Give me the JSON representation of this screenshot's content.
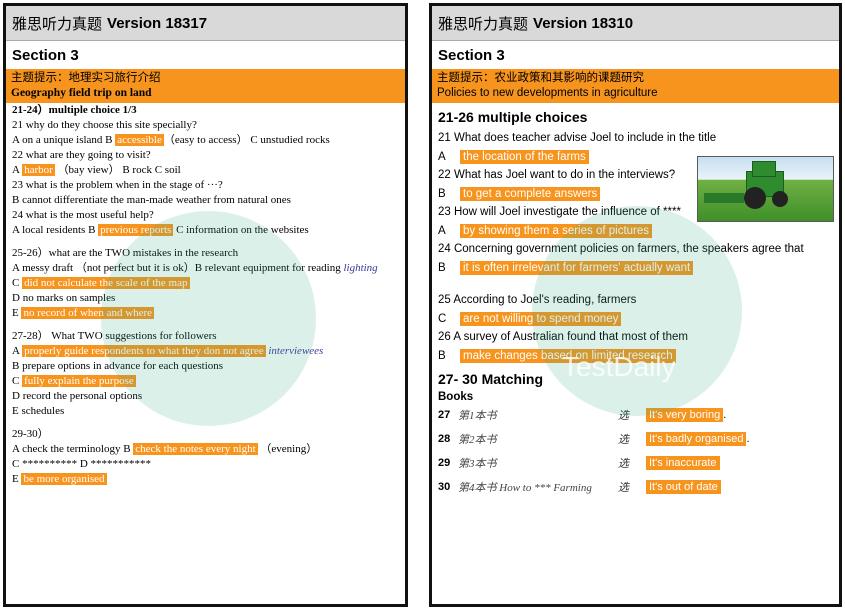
{
  "left": {
    "header_title": "雅思听力真题",
    "header_version": "Version 18317",
    "section": "Section 3",
    "topic_cn": "主题提示：地理实习旅行介绍",
    "topic_en": "Geography field trip on land",
    "q21_head": "21-24）multiple choice 1/3",
    "q21": "21 why do they choose this site specially?",
    "q21_a": "A on a unique island B",
    "q21_ans": "accessible",
    "q21_rest": "（easy to access） C unstudied rocks",
    "q22": "22 what are they going to visit?",
    "q22_a": "A",
    "q22_ans": "harbor",
    "q22_rest": "（bay view） B rock   C soil",
    "q23": "23 what is the problem when in the stage of ···?",
    "q23_b": "B cannot differentiate the man-made weather from natural ones",
    "q24": "24 what is the most useful help?",
    "q24_a": "A local residents        B",
    "q24_ans": "previous reports",
    "q24_rest": "C information on the websites",
    "q25_head": "25-26）what are the TWO mistakes in the research",
    "q25_a": "A messy draft  （not perfect but it is ok）B relevant equipment for reading",
    "q25_a_note": "lighting",
    "q25_c_letter": "C",
    "q25_c": "did not calculate the scale of the map",
    "q25_d": "D no marks on samples",
    "q25_e_letter": "E",
    "q25_e": "no record of when and where",
    "q27_head": "27-28）  What TWO suggestions for followers",
    "q27_a_letter": "A",
    "q27_a": "properly guide respondents to what they don not agree",
    "q27_a_note": "interviewees",
    "q27_b": "B prepare options in advance for each questions",
    "q27_c_letter": "C",
    "q27_c": "fully explain the purpose",
    "q27_d": "D record the personal options",
    "q27_e": "E schedules",
    "q29_head": "29-30）",
    "q29_a": "A check the terminology      B",
    "q29_ans": "check the notes every night",
    "q29_rest": "（evening）",
    "q29_cd": "C **********     D ***********",
    "q29_e_letter": "E",
    "q29_e": "be more organised"
  },
  "right": {
    "header_title": "雅思听力真题",
    "header_version": "Version 18310",
    "section": "Section 3",
    "topic_cn": "主题提示：农业政策和其影响的课题研究",
    "topic_en": "Policies to new developments in agriculture",
    "mc_head": "21-26 multiple choices",
    "q21": "21 What does teacher advise Joel to include in the title",
    "q21_letter": "A",
    "q21_ans": "the location of the farms",
    "q22": "22 What has Joel want to do in the interviews?",
    "q22_letter": "B",
    "q22_ans": "to get a complete answers",
    "q23": "23 How will Joel investigate the influence of ****",
    "q23_letter": "A",
    "q23_ans": "by showing them a series of pictures",
    "q24": "24 Concerning government policies on farmers, the speakers agree that",
    "q24_letter": "B",
    "q24_ans": "it is often irrelevant for farmers' actually want",
    "q25": "25 According to Joel's reading, farmers",
    "q25_letter": "C",
    "q25_ans": "are not willing to spend money",
    "q26": "26   A survey of Australian found that most of them",
    "q26_letter": "B",
    "q26_ans": "make changes based on limited research",
    "match_head": "27- 30 Matching",
    "books_label": "Books",
    "matches": [
      {
        "num": "27",
        "book": "第1本书",
        "sel": "选",
        "ans": "It's very boring",
        "tail": "."
      },
      {
        "num": "28",
        "book": "第2本书",
        "sel": "选",
        "ans": "It's badly organised",
        "tail": "."
      },
      {
        "num": "29",
        "book": "第3本书",
        "sel": "选",
        "ans": "It's inaccurate",
        "tail": ""
      },
      {
        "num": "30",
        "book": "第4本书 How to *** Farming",
        "sel": "选",
        "ans": "It's out of date",
        "tail": ""
      }
    ],
    "photo_caption": "Tractor"
  },
  "watermark": "TestDaily",
  "colors": {
    "highlight": "#f7941d",
    "header_bg": "#d9d9d9",
    "watermark": "#3caa8c"
  }
}
